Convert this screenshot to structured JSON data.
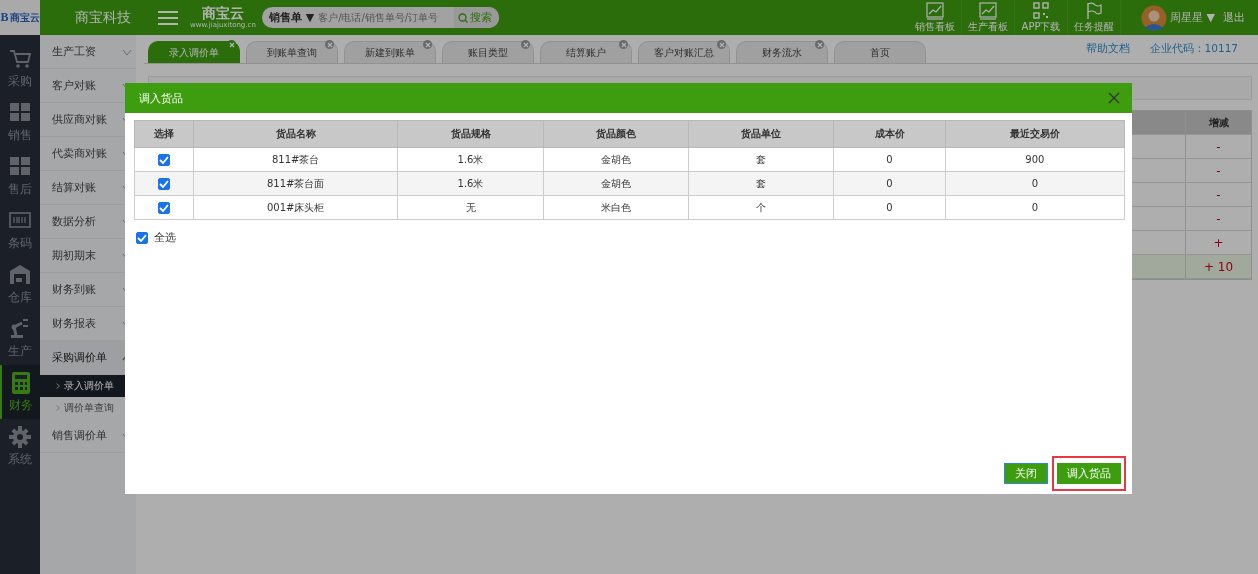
{
  "header": {
    "logo_letter": "B",
    "logo_text": "商宝云",
    "company": "商宝科技",
    "brand": {
      "name": "商宝云",
      "url": "www.jiajuxitong.cn"
    },
    "search": {
      "scope": "销售单 ▼",
      "placeholder": "客户/电话/销售单号/订单号",
      "button": "搜索"
    },
    "shortcuts": [
      {
        "label": "销售看板",
        "kind": "chart"
      },
      {
        "label": "生产看板",
        "kind": "chart"
      },
      {
        "label": "APP下载",
        "kind": "qr"
      },
      {
        "label": "任务提醒",
        "kind": "flag"
      }
    ],
    "user": {
      "name": "周星星 ▼",
      "logout": "退出"
    }
  },
  "rail": [
    {
      "label": "采购",
      "kind": "cart",
      "selected": false
    },
    {
      "label": "销售",
      "kind": "boxes",
      "selected": false
    },
    {
      "label": "售后",
      "kind": "boxes",
      "selected": false
    },
    {
      "label": "条码",
      "kind": "barcode",
      "selected": false
    },
    {
      "label": "仓库",
      "kind": "warehouse",
      "selected": false
    },
    {
      "label": "生产",
      "kind": "robot",
      "selected": false
    },
    {
      "label": "财务",
      "kind": "calculator",
      "selected": true
    },
    {
      "label": "系统",
      "kind": "gear",
      "selected": false
    }
  ],
  "sidebar": {
    "items": [
      {
        "label": "生产工资"
      },
      {
        "label": "客户对账"
      },
      {
        "label": "供应商对账"
      },
      {
        "label": "代卖商对账"
      },
      {
        "label": "结算对账"
      },
      {
        "label": "数据分析"
      },
      {
        "label": "期初期末"
      },
      {
        "label": "财务到账"
      },
      {
        "label": "财务报表"
      },
      {
        "label": "采购调价单",
        "expanded": true,
        "children": [
          {
            "label": "录入调价单",
            "selected": true
          },
          {
            "label": "调价单查询",
            "selected": false
          }
        ]
      },
      {
        "label": "销售调价单"
      }
    ]
  },
  "tabs": [
    {
      "label": "录入调价单",
      "selected": true,
      "closable": true
    },
    {
      "label": "到账单查询",
      "selected": false,
      "closable": true
    },
    {
      "label": "新建到账单",
      "selected": false,
      "closable": true
    },
    {
      "label": "账目类型",
      "selected": false,
      "closable": true
    },
    {
      "label": "结算账户",
      "selected": false,
      "closable": true
    },
    {
      "label": "客户对账汇总",
      "selected": false,
      "closable": true
    },
    {
      "label": "财务流水",
      "selected": false,
      "closable": true
    },
    {
      "label": "首页",
      "selected": false,
      "closable": false
    }
  ],
  "tab_links": [
    "帮助文档",
    "企业代码：10117"
  ],
  "background_table": {
    "column": "增减",
    "rows": [
      {
        "value": "-",
        "kind": "row"
      },
      {
        "value": "-",
        "kind": "row"
      },
      {
        "value": "-",
        "kind": "row"
      },
      {
        "value": "-",
        "kind": "row"
      },
      {
        "value": "+",
        "kind": "row"
      },
      {
        "value": "+ 10",
        "kind": "total"
      }
    ]
  },
  "dialog": {
    "title": "调入货品",
    "columns": [
      "选择",
      "货品名称",
      "货品规格",
      "货品颜色",
      "货品单位",
      "成本价",
      "最近交易价"
    ],
    "rows": [
      {
        "checked": true,
        "cells": [
          "",
          "811#茶台",
          "1.6米",
          "金胡色",
          "套",
          "0",
          "900"
        ]
      },
      {
        "checked": true,
        "cells": [
          "",
          "811#茶台面",
          "1.6米",
          "金胡色",
          "套",
          "0",
          "0"
        ]
      },
      {
        "checked": true,
        "cells": [
          "",
          "001#床头柜",
          "无",
          "米白色",
          "个",
          "0",
          "0"
        ]
      }
    ],
    "select_all": {
      "label": "全选",
      "checked": true
    },
    "buttons": [
      {
        "label": "关闭",
        "kind": "secondary",
        "highlighted": false
      },
      {
        "label": "调入货品",
        "kind": "primary",
        "highlighted": true
      }
    ]
  }
}
